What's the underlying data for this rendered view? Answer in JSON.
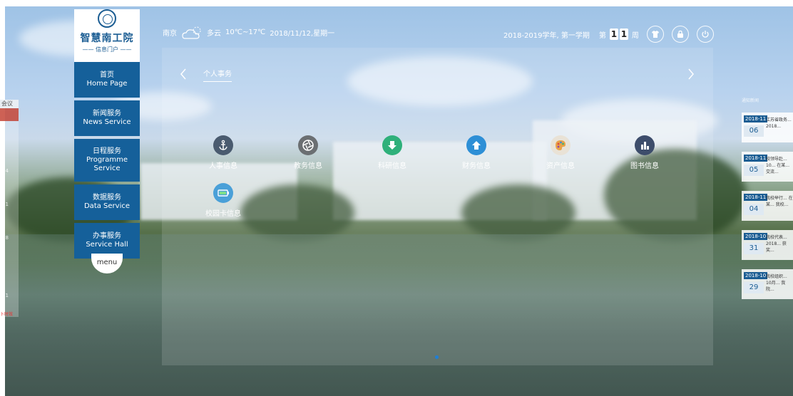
{
  "colors": {
    "accent": "#15609a",
    "brand": "#1b5d93",
    "pager_active": "#1e7fd8"
  },
  "sidebar": {
    "logo_title": "智慧南工院",
    "logo_sub": "—— 信息门户 ——",
    "items": [
      {
        "cn": "首页",
        "en": "Home Page"
      },
      {
        "cn": "新闻服务",
        "en": "News Service"
      },
      {
        "cn": "日程服务",
        "en": "Programme Service"
      },
      {
        "cn": "数据服务",
        "en": "Data Service"
      },
      {
        "cn": "办事服务",
        "en": "Service Hall"
      }
    ],
    "menu_label": "menu"
  },
  "topbar": {
    "city": "南京",
    "weather": "多云",
    "temp": "10℃~17℃",
    "date": "2018/11/12,星期一",
    "semester": "2018-2019学年, 第一学期",
    "week_prefix": "第",
    "week_digits": [
      "1",
      "1"
    ],
    "week_suffix": "周"
  },
  "panel": {
    "tab_title": "个人事务",
    "services": [
      {
        "label": "人事信息",
        "icon": "anchor-icon",
        "color": "#4a5b6f"
      },
      {
        "label": "教务信息",
        "icon": "aperture-icon",
        "color": "#6b6f72"
      },
      {
        "label": "科研信息",
        "icon": "download-arrow-icon",
        "color": "#2fb07a"
      },
      {
        "label": "财务信息",
        "icon": "upload-arrow-icon",
        "color": "#2e8fd6"
      },
      {
        "label": "资产信息",
        "icon": "palette-icon",
        "color": "#e8a24a"
      },
      {
        "label": "图书信息",
        "icon": "bar-chart-icon",
        "color": "#3d4d6b"
      },
      {
        "label": "校园卡信息",
        "icon": "battery-icon",
        "color": "#4aa0d8"
      }
    ]
  },
  "left_strip": {
    "header": "会议",
    "nums": [
      "7",
      "14",
      "21",
      "28",
      "4",
      "11"
    ],
    "tag": "卜时效"
  },
  "right_news": {
    "header": "通知新闻",
    "items": [
      {
        "ym": "2018-11",
        "d": "06",
        "text": "江苏省政务... 2018..."
      },
      {
        "ym": "2018-11",
        "d": "05",
        "text": "校领导赴... 10... 在某... 交流..."
      },
      {
        "ym": "2018-11",
        "d": "04",
        "text": "我校举行... 在某... 我校..."
      },
      {
        "ym": "2018-10",
        "d": "31",
        "text": "我校代表... 2018... 获奖..."
      },
      {
        "ym": "2018-10",
        "d": "29",
        "text": "我校组织... 10月... 我院..."
      }
    ]
  }
}
